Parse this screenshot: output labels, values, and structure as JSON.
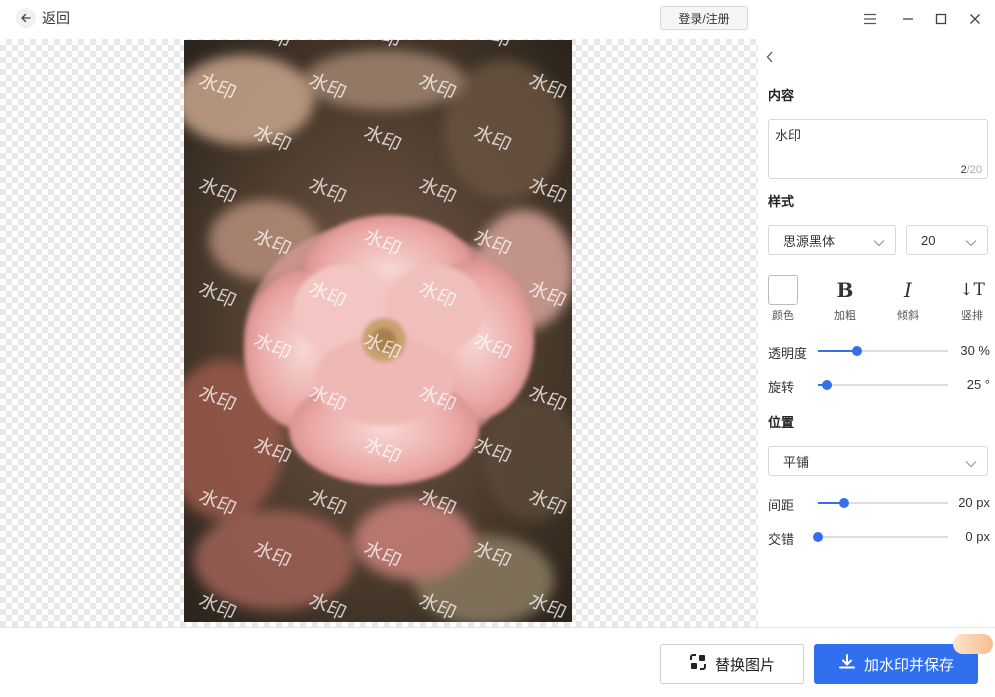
{
  "header": {
    "back_label": "返回",
    "login_label": "登录/注册"
  },
  "canvas": {
    "watermark_text": "水印"
  },
  "panel": {
    "content_title": "内容",
    "watermark_value": "水印",
    "char_count": "2",
    "char_max": "/20",
    "style_title": "样式",
    "font_value": "思源黑体",
    "size_value": "20",
    "style_options": {
      "color_label": "颜色",
      "bold_label": "加粗",
      "italic_label": "倾斜",
      "vertical_label": "竖排"
    },
    "opacity": {
      "label": "透明度",
      "value_text": "30 %",
      "fraction": 0.3
    },
    "rotate": {
      "label": "旋转",
      "value_text": "25 °",
      "fraction": 0.07
    },
    "position_title": "位置",
    "layout_value": "平铺",
    "spacing": {
      "label": "间距",
      "value_text": "20 px",
      "fraction": 0.2
    },
    "stagger": {
      "label": "交错",
      "value_text": "0 px",
      "fraction": 0.0
    }
  },
  "footer": {
    "replace_label": "替换图片",
    "save_label": "加水印并保存"
  },
  "colors": {
    "accent": "#2f6ff0",
    "slider": "#3670e8"
  }
}
